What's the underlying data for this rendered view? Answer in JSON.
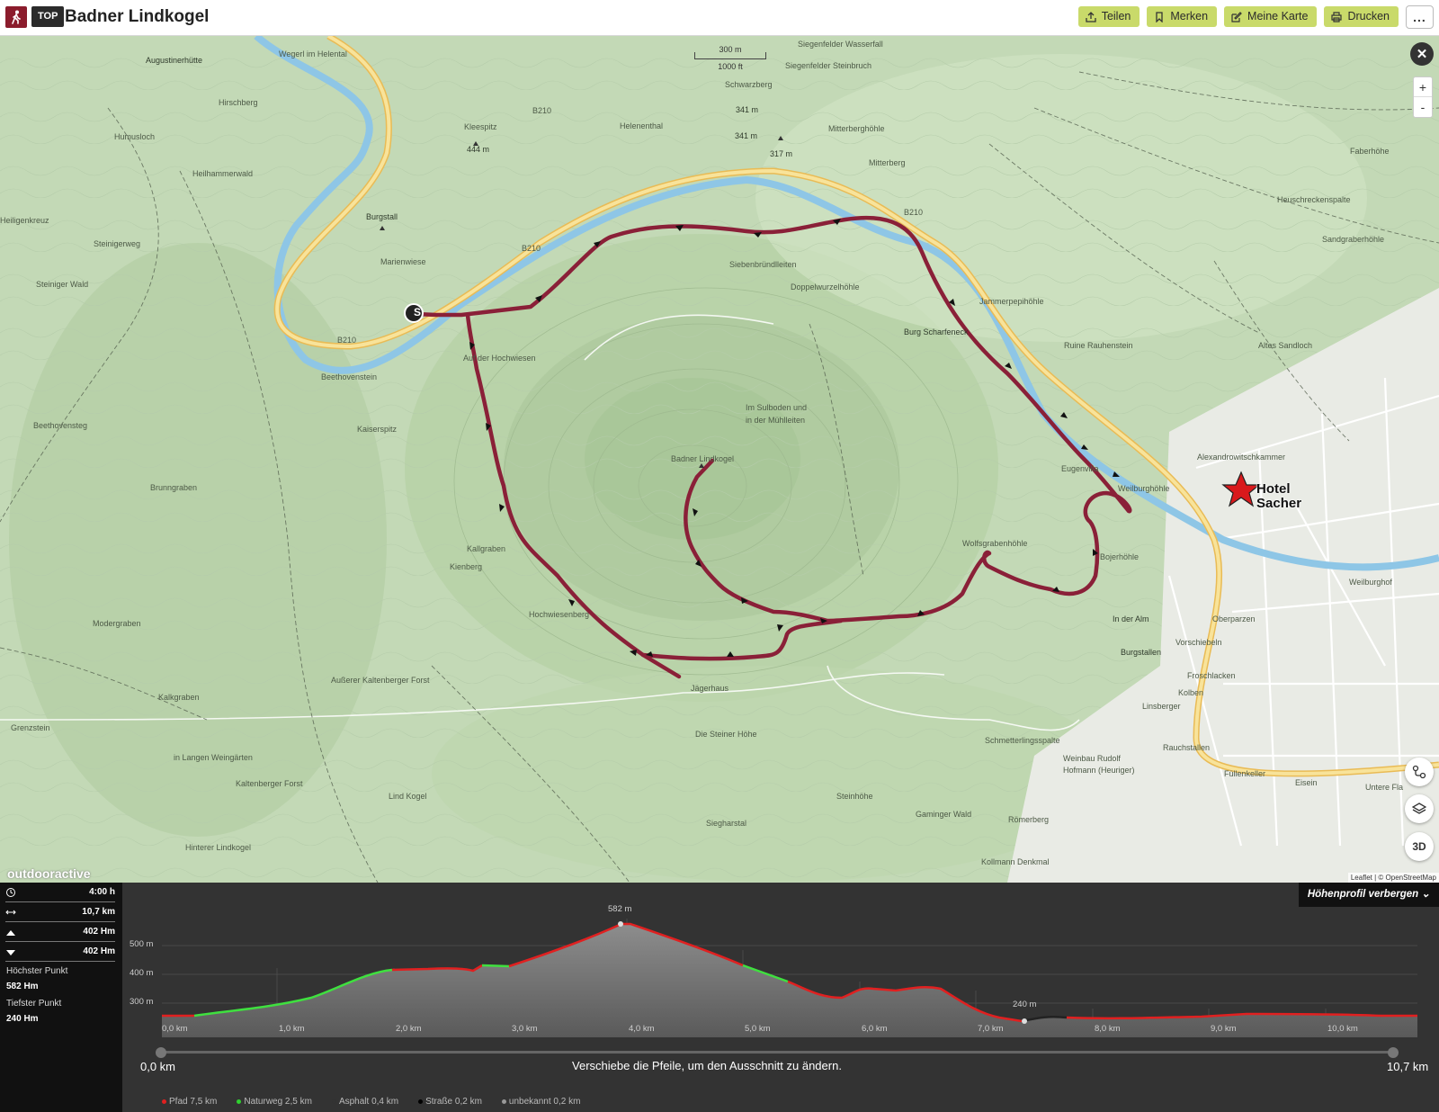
{
  "header": {
    "badge": "TOP",
    "title": "Badner Lindkogel",
    "actions": [
      {
        "label": "Teilen",
        "icon": "share-icon"
      },
      {
        "label": "Merken",
        "icon": "bookmark-icon"
      },
      {
        "label": "Meine Karte",
        "icon": "edit-map-icon"
      },
      {
        "label": "Drucken",
        "icon": "print-icon"
      }
    ],
    "more": "..."
  },
  "map": {
    "scale": {
      "metric": "300 m",
      "imperial": "1000 ft"
    },
    "hotel_line1": "Hotel",
    "hotel_line2": "Sacher",
    "start_marker": "S",
    "logo": "outdooractive",
    "attribution": "Leaflet | © OpenStreetMap",
    "controls": {
      "zoom_in": "+",
      "zoom_out": "-",
      "mode_3d": "3D",
      "close": "✕"
    },
    "labels": [
      "Augustinerhütte",
      "Wegerl im Helental",
      "Hirschberg",
      "Humusloch",
      "Heiligenkreuz",
      "Heilhammerwald",
      "Kleespitz",
      "444 m",
      "Helenenthal",
      "Siegenfelder Wasserfall",
      "Siegenfelder Steinbruch",
      "Schwarzberg",
      "341 m",
      "341 m",
      "317 m",
      "Mitterberghöhle",
      "Mitterberg",
      "Faberhöhe",
      "Heuschreckenspalte",
      "Sandgraberhöhle",
      "Burgstall",
      "Marienwiese",
      "Steinigerweg",
      "Steiniger Wald",
      "Siebenbründlleiten",
      "Doppelwurzelhöhle",
      "Jammerpepihöhle",
      "Burg Scharfeneck",
      "Ruine Rauhenstein",
      "Altes Sandloch",
      "Beethovenstein",
      "Auf der Hochwiesen",
      "Im Sulboden und",
      "in der Mühlleiten",
      "Badner Lindkogel",
      "Kaiserspitz",
      "Beethovensteg",
      "Brunngraben",
      "Eugenvilla",
      "Weilburghöhle",
      "Alexandrowitschkammer",
      "Kallgraben",
      "Kienberg",
      "Wolfsgrabenhöhle",
      "Bojerhöhle",
      "Weilburghof",
      "Hochwiesenberg",
      "In der Alm",
      "Oberparzen",
      "Vorschiebeln",
      "Modergraben",
      "Burgstallen",
      "Froschlacken",
      "Kolben",
      "Linsberger",
      "Außerer Kaltenberger Forst",
      "Jägerhaus",
      "Grenzstein",
      "Kalkgraben",
      "Die Steiner Höhe",
      "Schmetterlingsspalte",
      "Rauchstallen",
      "Weinbau Rudolf",
      "Hofmann (Heuriger)",
      "Füllenkeller",
      "Eisein",
      "Untere Fla",
      "in Langen Weingärten",
      "Kaltenberger Forst",
      "Lind Kogel",
      "Steinhöhe",
      "Gaminger Wald",
      "Römerberg",
      "Hinterer Lindkogel",
      "Kollmann Denkmal",
      "Siegharstal",
      "B210",
      "B210",
      "B210",
      "B210"
    ]
  },
  "stats": {
    "duration": "4:00 h",
    "distance": "10,7 km",
    "ascent": "402 Hm",
    "descent": "402 Hm",
    "highest_label": "Höchster Punkt",
    "highest_value": "582 Hm",
    "lowest_label": "Tiefster Punkt",
    "lowest_value": "240 Hm"
  },
  "profile": {
    "hide_label": "Höhenprofil verbergen",
    "max_label": "582 m",
    "min_label": "240 m",
    "y_ticks": [
      "500 m",
      "400 m",
      "300 m"
    ],
    "x_ticks": [
      "0,0 km",
      "1,0 km",
      "2,0 km",
      "3,0 km",
      "4,0 km",
      "5,0 km",
      "6,0 km",
      "7,0 km",
      "8,0 km",
      "9,0 km",
      "10,0 km"
    ],
    "range_start": "0,0 km",
    "range_end": "10,7 km",
    "range_hint": "Verschiebe die Pfeile, um den Ausschnitt zu ändern.",
    "legend": [
      {
        "label": "Pfad 7,5 km",
        "color": "#e02020"
      },
      {
        "label": "Naturweg 2,5 km",
        "color": "#2fd12f"
      },
      {
        "label": "Asphalt 0,4 km",
        "color": "#333333"
      },
      {
        "label": "Straße 0,2 km",
        "color": "#000000"
      },
      {
        "label": "unbekannt 0,2 km",
        "color": "#999999"
      }
    ]
  }
}
